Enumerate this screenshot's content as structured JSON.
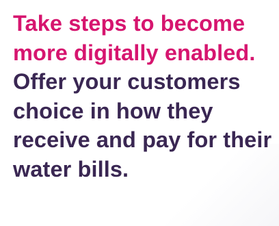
{
  "content": {
    "highlight": "Take steps to become more digitally enabled.",
    "body": "Offer your customers choice in how they receive and pay for their water bills."
  },
  "colors": {
    "highlight": "#d6156f",
    "body": "#3a2753"
  }
}
